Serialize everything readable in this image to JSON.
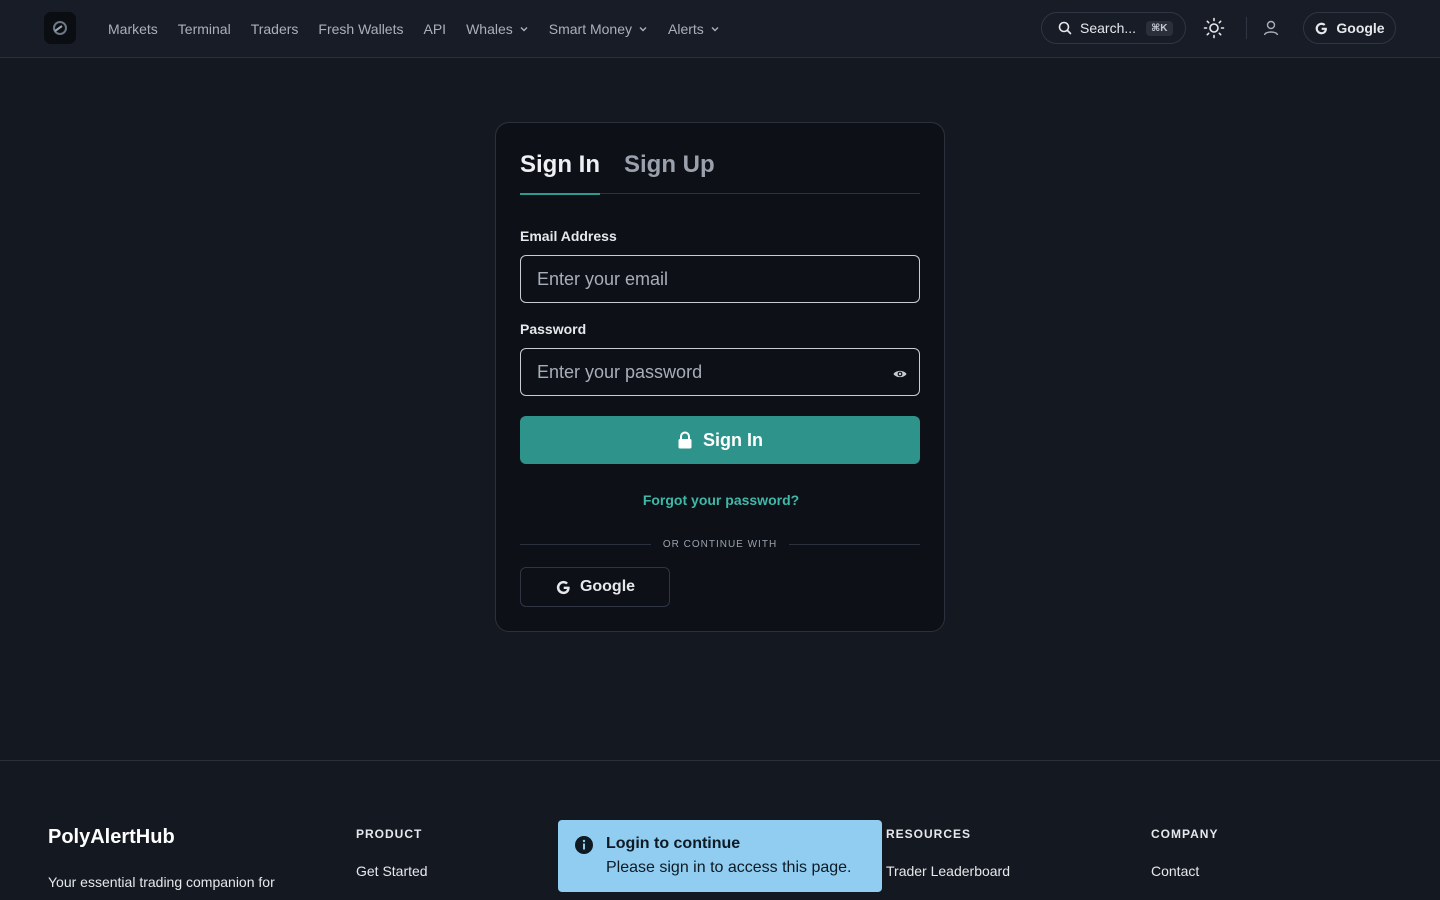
{
  "nav": {
    "items": [
      {
        "label": "Markets",
        "dropdown": false
      },
      {
        "label": "Terminal",
        "dropdown": false
      },
      {
        "label": "Traders",
        "dropdown": false
      },
      {
        "label": "Fresh Wallets",
        "dropdown": false
      },
      {
        "label": "API",
        "dropdown": false
      },
      {
        "label": "Whales",
        "dropdown": true
      },
      {
        "label": "Smart Money",
        "dropdown": true
      },
      {
        "label": "Alerts",
        "dropdown": true
      }
    ],
    "search_label": "Search...",
    "search_shortcut": "⌘K",
    "google_label": "Google"
  },
  "auth": {
    "tabs": [
      "Sign In",
      "Sign Up"
    ],
    "active_tab": "Sign In",
    "email_label": "Email Address",
    "email_placeholder": "Enter your email",
    "email_value": "",
    "password_label": "Password",
    "password_placeholder": "Enter your password",
    "password_value": "",
    "submit_label": "Sign In",
    "forgot_label": "Forgot your password?",
    "divider_text": "OR CONTINUE WITH",
    "google_label": "Google"
  },
  "footer": {
    "brand": "PolyAlertHub",
    "description": "Your essential trading companion for",
    "columns": [
      {
        "heading": "PRODUCT",
        "links": [
          "Get Started"
        ]
      },
      {
        "heading": "RESOURCES",
        "links": [
          "Trader Leaderboard"
        ]
      },
      {
        "heading": "COMPANY",
        "links": [
          "Contact"
        ]
      }
    ]
  },
  "toast": {
    "title": "Login to continue",
    "message": "Please sign in to access this page.",
    "background": "#90cdf0"
  },
  "colors": {
    "accent": "#2e948b",
    "link": "#3fb8a9",
    "background": "#141820",
    "card": "#0d1117"
  }
}
